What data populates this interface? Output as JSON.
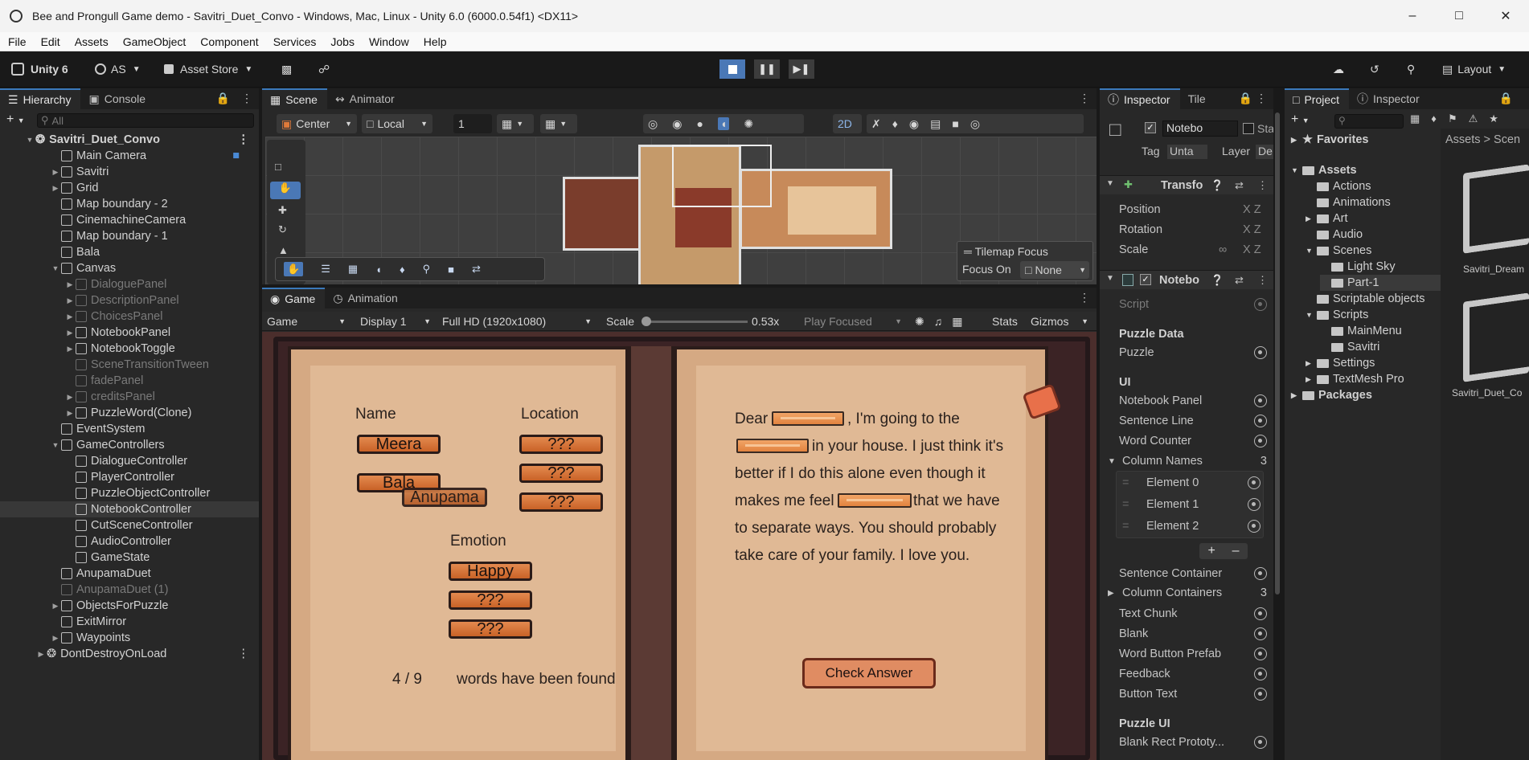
{
  "window": {
    "title": "Bee and Prongull Game demo - Savitri_Duet_Convo - Windows, Mac, Linux - Unity 6.0 (6000.0.54f1) <DX11>"
  },
  "menu": [
    "File",
    "Edit",
    "Assets",
    "GameObject",
    "Component",
    "Services",
    "Jobs",
    "Window",
    "Help"
  ],
  "toolbar": {
    "product": "Unity 6",
    "account": "AS",
    "asset_store": "Asset Store",
    "layout": "Layout"
  },
  "hierarchy": {
    "tabs": [
      "Hierarchy",
      "Console"
    ],
    "search_placeholder": "All",
    "scene": "Savitri_Duet_Convo",
    "items": [
      {
        "label": "Main Camera"
      },
      {
        "label": "Savitri"
      },
      {
        "label": "Grid"
      },
      {
        "label": "Map boundary - 2"
      },
      {
        "label": "CinemachineCamera"
      },
      {
        "label": "Map boundary - 1"
      },
      {
        "label": "Bala"
      },
      {
        "label": "Canvas"
      },
      {
        "label": "DialoguePanel"
      },
      {
        "label": "DescriptionPanel"
      },
      {
        "label": "ChoicesPanel"
      },
      {
        "label": "NotebookPanel"
      },
      {
        "label": "NotebookToggle"
      },
      {
        "label": "SceneTransitionTween"
      },
      {
        "label": "fadePanel"
      },
      {
        "label": "creditsPanel"
      },
      {
        "label": "PuzzleWord(Clone)"
      },
      {
        "label": "EventSystem"
      },
      {
        "label": "GameControllers"
      },
      {
        "label": "DialogueController"
      },
      {
        "label": "PlayerController"
      },
      {
        "label": "PuzzleObjectController"
      },
      {
        "label": "NotebookController"
      },
      {
        "label": "CutSceneController"
      },
      {
        "label": "AudioController"
      },
      {
        "label": "GameState"
      },
      {
        "label": "AnupamaDuet"
      },
      {
        "label": "AnupamaDuet (1)"
      },
      {
        "label": "ObjectsForPuzzle"
      },
      {
        "label": "ExitMirror"
      },
      {
        "label": "Waypoints"
      },
      {
        "label": "DontDestroyOnLoad"
      }
    ]
  },
  "scene": {
    "tabs": [
      "Scene",
      "Animator"
    ],
    "pivot": "Center",
    "space": "Local",
    "grid_value": "1",
    "mode_2d": "2D",
    "tilemap_focus": "Tilemap Focus",
    "focus_on_label": "Focus On",
    "focus_on_value": "None"
  },
  "game": {
    "tabs": [
      "Game",
      "Animation"
    ],
    "view": "Game",
    "display": "Display 1",
    "resolution": "Full HD (1920x1080)",
    "scale_label": "Scale",
    "scale_value": "0.53x",
    "play_mode": "Play Focused",
    "stats": "Stats",
    "gizmos": "Gizmos"
  },
  "notebook": {
    "name_header": "Name",
    "location_header": "Location",
    "emotion_header": "Emotion",
    "names": [
      "Meera",
      "Bala"
    ],
    "dragged_word": "Anupama",
    "locations": [
      "???",
      "???",
      "???"
    ],
    "emotions": [
      "Happy",
      "???",
      "???"
    ],
    "found_count": "4 / 9",
    "found_text": "words have been found",
    "letter": {
      "w1": "Dear",
      "w2": ", I'm going to the",
      "w3": "in your house. I just think it's",
      "w4": "better if I do this alone even though it",
      "w5": "makes me feel",
      "w6": "that we have",
      "w7": "to separate ways. You should probably",
      "w8": "take care of your family. I love you."
    },
    "check_button": "Check Answer"
  },
  "inspector": {
    "tabs": [
      "Inspector",
      "Tile"
    ],
    "object_name": "Notebo",
    "static_label": "Static",
    "tag_label": "Tag",
    "tag_value": "Unta",
    "layer_label": "Layer",
    "layer_value": "De",
    "transform": "Transfo",
    "position": "Position",
    "rotation": "Rotation",
    "scale": "Scale",
    "component": "Notebo",
    "script": "Script",
    "puzzle_data_header": "Puzzle Data",
    "puzzle": "Puzzle",
    "ui_header": "UI",
    "fields": [
      "Notebook Panel",
      "Sentence Line",
      "Word Counter"
    ],
    "column_names": "Column Names",
    "column_names_count": "3",
    "elements": [
      "Element 0",
      "Element 1",
      "Element 2"
    ],
    "fields2": [
      "Sentence Container"
    ],
    "column_containers": "Column Containers",
    "column_containers_count": "3",
    "fields3": [
      "Text Chunk",
      "Blank",
      "Word Button Prefab",
      "Feedback",
      "Button Text"
    ],
    "puzzle_ui_header": "Puzzle UI",
    "blank_rect": "Blank Rect Prototy..."
  },
  "project": {
    "tabs": [
      "Project",
      "Inspector"
    ],
    "favorites": "Favorites",
    "assets": "Assets",
    "folders": [
      "Actions",
      "Animations",
      "Art",
      "Audio",
      "Scenes",
      "Light Sky",
      "Part-1",
      "Scriptable objects",
      "Scripts",
      "MainMenu",
      "Savitri",
      "Settings",
      "TextMesh Pro"
    ],
    "packages": "Packages",
    "breadcrumb": "Assets > Scen",
    "asset_items": [
      "Savitri_Dream",
      "Savitri_Duet_Co"
    ]
  }
}
